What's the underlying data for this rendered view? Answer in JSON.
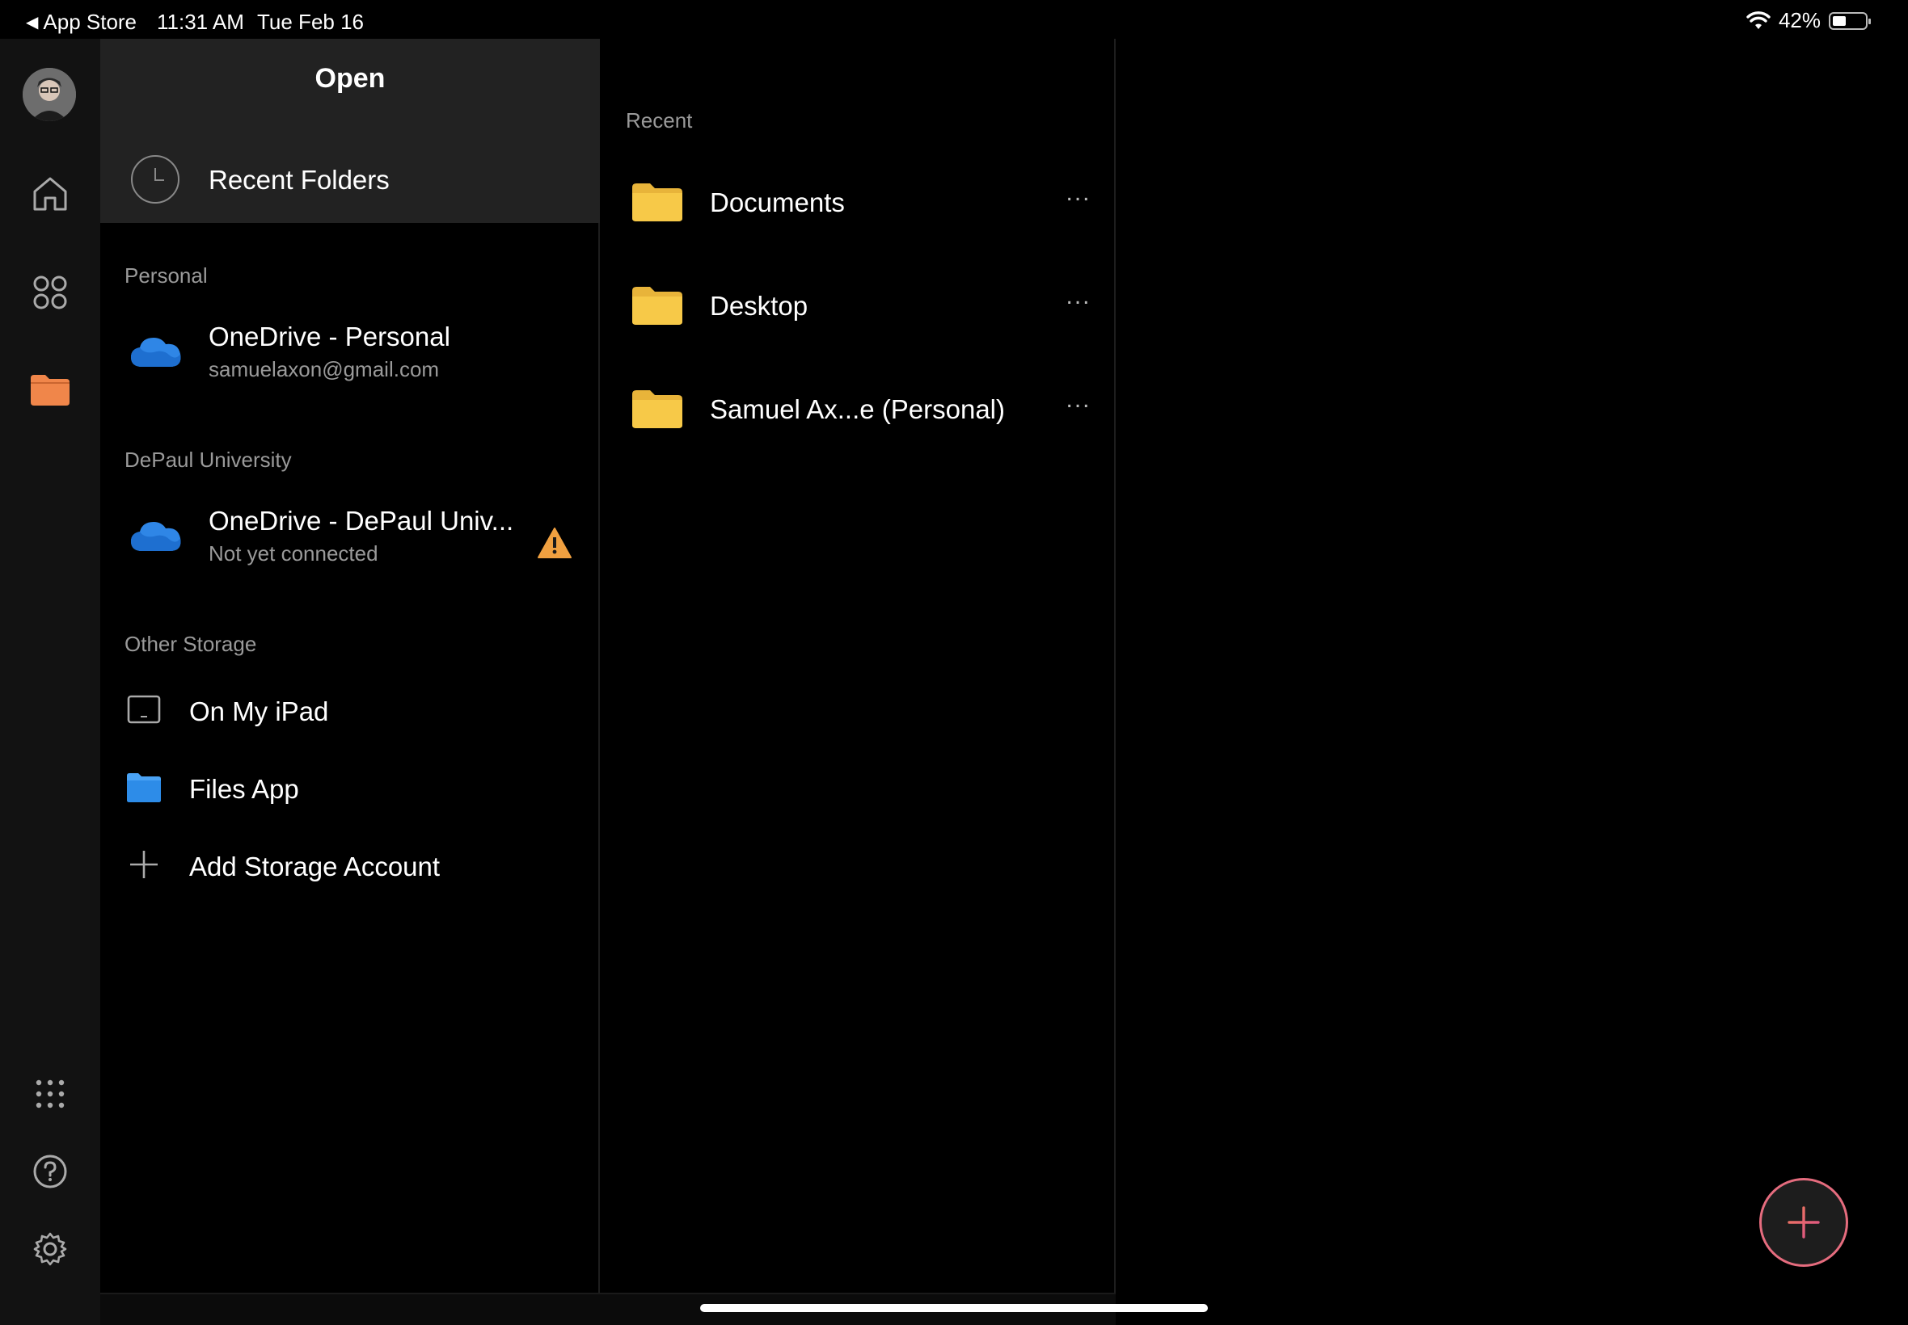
{
  "status_bar": {
    "back_app": "App Store",
    "time": "11:31 AM",
    "date": "Tue Feb 16",
    "battery": "42%",
    "battery_level": 0.42
  },
  "nav_rail": {
    "icons": [
      "avatar",
      "home-icon",
      "apps-icon",
      "folder-icon",
      "grid-dots-icon",
      "help-icon",
      "gear-icon"
    ],
    "active": "folder-icon",
    "accent": "#f0864a"
  },
  "sidebar": {
    "title": "Open",
    "recent_folders": "Recent Folders",
    "sections": [
      {
        "label": "Personal",
        "account": {
          "name": "OneDrive - Personal",
          "sub": "samuelaxon@gmail.com"
        }
      },
      {
        "label": "DePaul University",
        "account": {
          "name": "OneDrive - DePaul Univ...",
          "sub": "Not yet connected",
          "warning": true
        }
      }
    ],
    "other_storage": {
      "label": "Other Storage",
      "items": [
        "On My iPad",
        "Files App",
        "Add Storage Account"
      ]
    }
  },
  "recent": {
    "label": "Recent",
    "folders": [
      "Documents",
      "Desktop",
      "Samuel Ax...e (Personal)"
    ],
    "more_label": "..."
  },
  "colors": {
    "folder_yellow": "#f7c948",
    "onedrive_blue": "#2f86e6",
    "warning": "#f0a040",
    "fab_ring": "#e56c7e"
  }
}
